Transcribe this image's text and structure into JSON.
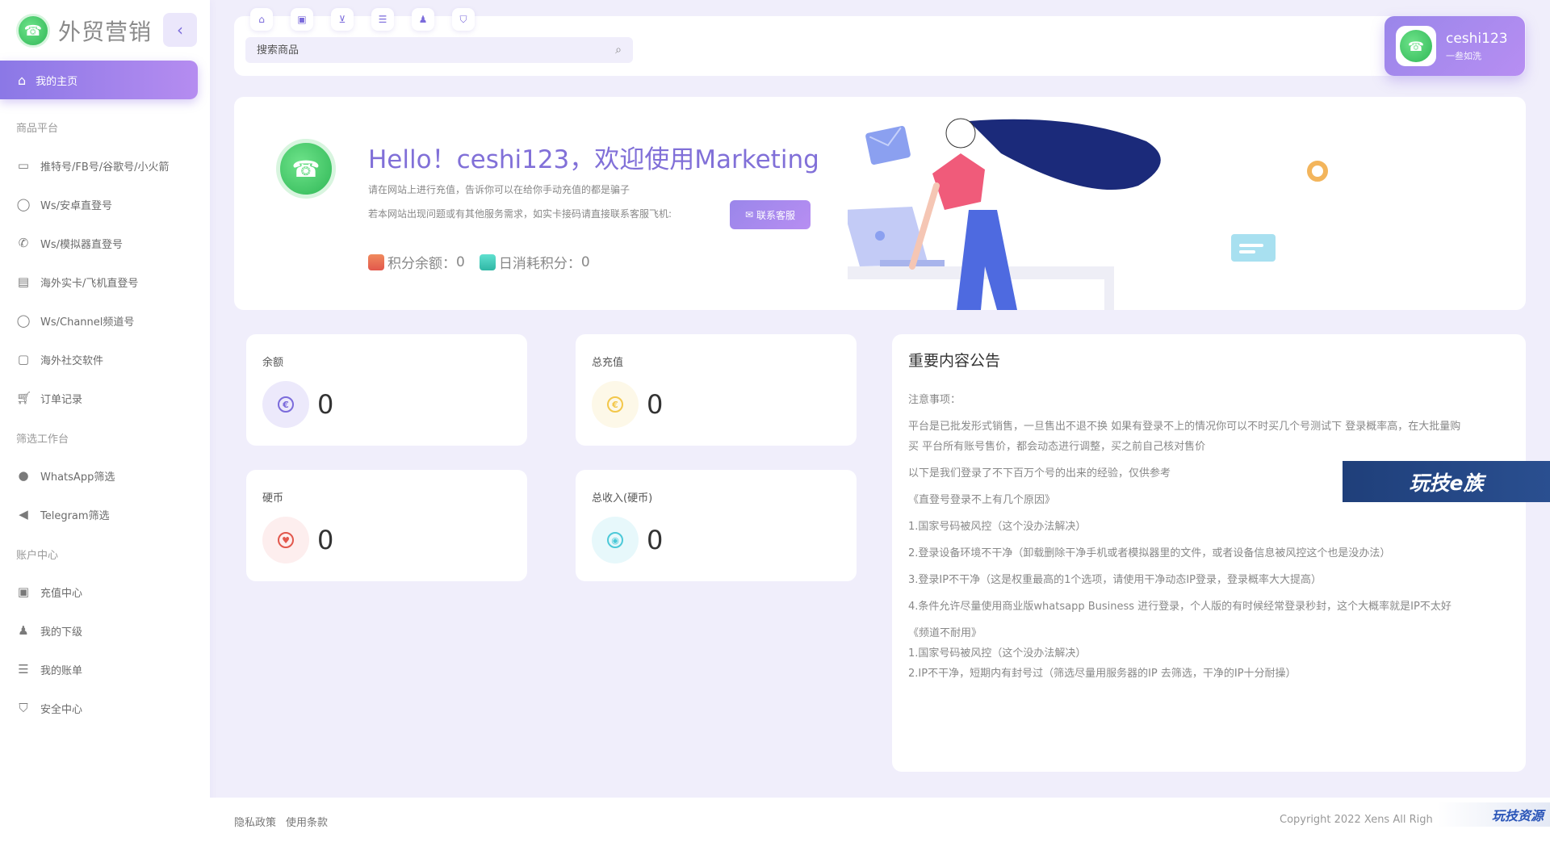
{
  "brand": {
    "name": "外贸营销"
  },
  "sidebar": {
    "active": {
      "label": "我的主页",
      "icon": "home-icon"
    },
    "groups": [
      {
        "title": "商品平台"
      },
      {
        "title": "筛选工作台"
      },
      {
        "title": "账户中心"
      }
    ],
    "items": [
      {
        "label": "推特号/FB号/谷歌号/小火箭",
        "icon": "message-square-icon"
      },
      {
        "label": "Ws/安卓直登号",
        "icon": "whatsapp-icon"
      },
      {
        "label": "Ws/模拟器直登号",
        "icon": "phone-icon"
      },
      {
        "label": "海外实卡/飞机直登号",
        "icon": "sim-card-icon"
      },
      {
        "label": "Ws/Channel频道号",
        "icon": "whatsapp-icon"
      },
      {
        "label": "海外社交软件",
        "icon": "facebook-icon"
      },
      {
        "label": "订单记录",
        "icon": "cart-icon"
      },
      {
        "label": "WhatsApp筛选",
        "icon": "whatsapp-icon"
      },
      {
        "label": "Telegram筛选",
        "icon": "telegram-icon"
      },
      {
        "label": "充值中心",
        "icon": "wallet-icon"
      },
      {
        "label": "我的下级",
        "icon": "user-star-icon"
      },
      {
        "label": "我的账单",
        "icon": "bill-icon"
      },
      {
        "label": "安全中心",
        "icon": "shield-icon"
      }
    ]
  },
  "topbar": {
    "quick_icons": [
      "home-icon",
      "wallet-icon",
      "cart-icon",
      "bill-icon",
      "user-star-icon",
      "shield-icon"
    ],
    "search": {
      "placeholder": "搜索商品",
      "value": ""
    }
  },
  "user": {
    "name": "ceshi123",
    "subtitle": "一叁如洗"
  },
  "hero": {
    "title": "Hello！ceshi123，欢迎使用Marketing",
    "line1": "请在网站上进行充值，告诉你可以在给你手动充值的都是骗子",
    "line2": "若本网站出现问题或有其他服务需求，如实卡接码请直接联系客服飞机:",
    "contact_label": "联系客服",
    "balance_label": "积分余额：",
    "balance_value": "0",
    "daily_label": "日消耗积分：",
    "daily_value": "0"
  },
  "cards": [
    {
      "label": "余额",
      "value": "0",
      "icon": "euro-icon",
      "color": "#7b6bdb",
      "bg": "#ece9fb"
    },
    {
      "label": "总充值",
      "value": "0",
      "icon": "euro-icon",
      "color": "#f3c74a",
      "bg": "#fdf8e8"
    },
    {
      "label": "硬币",
      "value": "0",
      "icon": "heart-icon",
      "color": "#e2574c",
      "bg": "#fdeeee"
    },
    {
      "label": "总收入(硬币)",
      "value": "0",
      "icon": "target-icon",
      "color": "#4cc9d8",
      "bg": "#e7f8fb"
    }
  ],
  "notice": {
    "title": "重要内容公告",
    "lines": [
      "注意事项：",
      "平台是已批发形式销售，一旦售出不退不换 如果有登录不上的情况你可以不时买几个号测试下 登录概率高，在大批量购",
      "买 平台所有账号售价，都会动态进行调整，买之前自己核对售价",
      "以下是我们登录了不下百万个号的出来的经验，仅供参考",
      "《直登号登录不上有几个原因》",
      "1.国家号码被风控（这个没办法解决）",
      "2.登录设备环境不干净（卸载删除干净手机或者模拟器里的文件，或者设备信息被风控这个也是没办法）",
      "3.登录IP不干净（这是权重最高的1个选项，请使用干净动态IP登录，登录概率大大提高）",
      "4.条件允许尽量使用商业版whatsapp Business 进行登录，个人版的有时候经常登录秒封，这个大概率就是IP不太好",
      "《频道不耐用》",
      "1.国家号码被风控（这个没办法解决）",
      "2.IP不干净，短期内有封号过（筛选尽量用服务器的IP 去筛选，干净的IP十分耐操）"
    ]
  },
  "watermark": {
    "text": "玩技e族"
  },
  "footer": {
    "privacy": "隐私政策",
    "terms": "使用条款",
    "copyright": "Copyright 2022 Xens All Righ",
    "badge": "玩技资源"
  }
}
